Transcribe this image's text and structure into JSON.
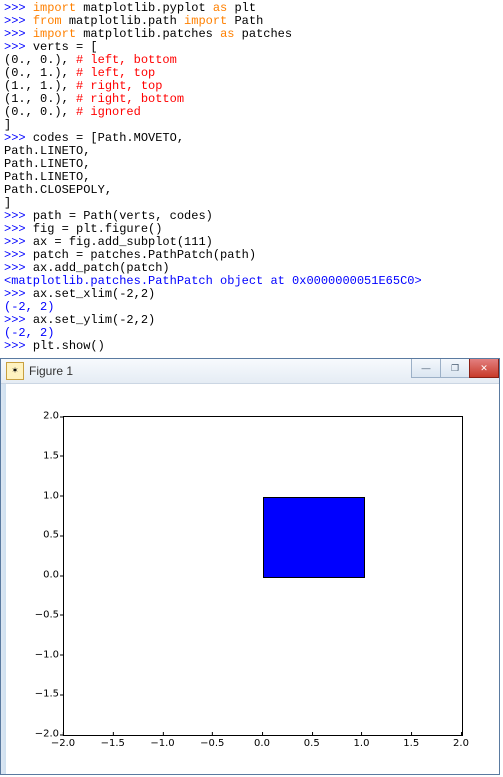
{
  "console": {
    "lines": [
      {
        "t": "code",
        "segments": [
          {
            "c": "prompt",
            "v": ">>> "
          },
          {
            "c": "kw-orange",
            "v": "import"
          },
          {
            "c": "plain",
            "v": " matplotlib.pyplot "
          },
          {
            "c": "kw-orange",
            "v": "as"
          },
          {
            "c": "plain",
            "v": " plt"
          }
        ]
      },
      {
        "t": "code",
        "segments": [
          {
            "c": "prompt",
            "v": ">>> "
          },
          {
            "c": "kw-orange",
            "v": "from"
          },
          {
            "c": "plain",
            "v": " matplotlib.path "
          },
          {
            "c": "kw-orange",
            "v": "import"
          },
          {
            "c": "plain",
            "v": " Path"
          }
        ]
      },
      {
        "t": "code",
        "segments": [
          {
            "c": "prompt",
            "v": ">>> "
          },
          {
            "c": "kw-orange",
            "v": "import"
          },
          {
            "c": "plain",
            "v": " matplotlib.patches "
          },
          {
            "c": "kw-orange",
            "v": "as"
          },
          {
            "c": "plain",
            "v": " patches"
          }
        ]
      },
      {
        "t": "code",
        "segments": [
          {
            "c": "prompt",
            "v": ">>> "
          },
          {
            "c": "plain",
            "v": "verts = ["
          }
        ]
      },
      {
        "t": "code",
        "segments": [
          {
            "c": "plain",
            "v": "(0., 0.), "
          },
          {
            "c": "comment",
            "v": "# left, bottom"
          }
        ]
      },
      {
        "t": "code",
        "segments": [
          {
            "c": "plain",
            "v": "(0., 1.), "
          },
          {
            "c": "comment",
            "v": "# left, top"
          }
        ]
      },
      {
        "t": "code",
        "segments": [
          {
            "c": "plain",
            "v": "(1., 1.), "
          },
          {
            "c": "comment",
            "v": "# right, top"
          }
        ]
      },
      {
        "t": "code",
        "segments": [
          {
            "c": "plain",
            "v": "(1., 0.), "
          },
          {
            "c": "comment",
            "v": "# right, bottom"
          }
        ]
      },
      {
        "t": "code",
        "segments": [
          {
            "c": "plain",
            "v": "(0., 0.), "
          },
          {
            "c": "comment",
            "v": "# ignored"
          }
        ]
      },
      {
        "t": "code",
        "segments": [
          {
            "c": "plain",
            "v": "]"
          }
        ]
      },
      {
        "t": "code",
        "segments": [
          {
            "c": "prompt",
            "v": ">>> "
          },
          {
            "c": "plain",
            "v": "codes = [Path.MOVETO,"
          }
        ]
      },
      {
        "t": "code",
        "segments": [
          {
            "c": "plain",
            "v": "Path.LINETO,"
          }
        ]
      },
      {
        "t": "code",
        "segments": [
          {
            "c": "plain",
            "v": "Path.LINETO,"
          }
        ]
      },
      {
        "t": "code",
        "segments": [
          {
            "c": "plain",
            "v": "Path.LINETO,"
          }
        ]
      },
      {
        "t": "code",
        "segments": [
          {
            "c": "plain",
            "v": "Path.CLOSEPOLY,"
          }
        ]
      },
      {
        "t": "code",
        "segments": [
          {
            "c": "plain",
            "v": "]"
          }
        ]
      },
      {
        "t": "code",
        "segments": [
          {
            "c": "prompt",
            "v": ">>> "
          },
          {
            "c": "plain",
            "v": "path = Path(verts, codes)"
          }
        ]
      },
      {
        "t": "code",
        "segments": [
          {
            "c": "prompt",
            "v": ">>> "
          },
          {
            "c": "plain",
            "v": "fig = plt.figure()"
          }
        ]
      },
      {
        "t": "code",
        "segments": [
          {
            "c": "prompt",
            "v": ">>> "
          },
          {
            "c": "plain",
            "v": "ax = fig.add_subplot(111)"
          }
        ]
      },
      {
        "t": "code",
        "segments": [
          {
            "c": "prompt",
            "v": ">>> "
          },
          {
            "c": "plain",
            "v": "patch = patches.PathPatch(path)"
          }
        ]
      },
      {
        "t": "code",
        "segments": [
          {
            "c": "prompt",
            "v": ">>> "
          },
          {
            "c": "plain",
            "v": "ax.add_patch(patch)"
          }
        ]
      },
      {
        "t": "output",
        "segments": [
          {
            "c": "output",
            "v": "<matplotlib.patches.PathPatch object at 0x0000000051E65C0>"
          }
        ]
      },
      {
        "t": "code",
        "segments": [
          {
            "c": "prompt",
            "v": ">>> "
          },
          {
            "c": "plain",
            "v": "ax.set_xlim(-2,2)"
          }
        ]
      },
      {
        "t": "output",
        "segments": [
          {
            "c": "output",
            "v": "(-2, 2)"
          }
        ]
      },
      {
        "t": "code",
        "segments": [
          {
            "c": "prompt",
            "v": ">>> "
          },
          {
            "c": "plain",
            "v": "ax.set_ylim(-2,2)"
          }
        ]
      },
      {
        "t": "output",
        "segments": [
          {
            "c": "output",
            "v": "(-2, 2)"
          }
        ]
      },
      {
        "t": "code",
        "segments": [
          {
            "c": "prompt",
            "v": ">>> "
          },
          {
            "c": "plain",
            "v": "plt.show()"
          }
        ]
      }
    ]
  },
  "window": {
    "title": "Figure 1",
    "icon_glyph": "✶",
    "min_label": "—",
    "max_label": "❐",
    "close_label": "✕"
  },
  "chart_data": {
    "type": "patch-on-axes",
    "xlim": [
      -2,
      2
    ],
    "ylim": [
      -2,
      2
    ],
    "xticks": [
      "−2.0",
      "−1.5",
      "−1.0",
      "−0.5",
      "0.0",
      "0.5",
      "1.0",
      "1.5",
      "2.0"
    ],
    "yticks": [
      "−2.0",
      "−1.5",
      "−1.0",
      "−0.5",
      "0.0",
      "0.5",
      "1.0",
      "1.5",
      "2.0"
    ],
    "xtick_vals": [
      -2.0,
      -1.5,
      -1.0,
      -0.5,
      0.0,
      0.5,
      1.0,
      1.5,
      2.0
    ],
    "ytick_vals": [
      -2.0,
      -1.5,
      -1.0,
      -0.5,
      0.0,
      0.5,
      1.0,
      1.5,
      2.0
    ],
    "patch": {
      "x0": 0,
      "y0": 0,
      "x1": 1,
      "y1": 1,
      "facecolor": "#0000ff",
      "edgecolor": "#000000"
    }
  }
}
